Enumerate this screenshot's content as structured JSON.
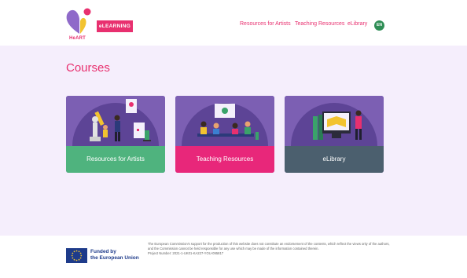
{
  "header": {
    "logo_text": "HeART",
    "badge": "eLEARNING",
    "nav": [
      {
        "label": "Resources for Artists"
      },
      {
        "label": "Teaching Resources"
      },
      {
        "label": "eLibrary"
      }
    ],
    "language": "EN"
  },
  "main": {
    "title": "Courses",
    "cards": [
      {
        "label": "Resources for Artists",
        "color": "#4fb37e"
      },
      {
        "label": "Teaching Resources",
        "color": "#e8277a"
      },
      {
        "label": "eLibrary",
        "color": "#4b5f6e"
      }
    ]
  },
  "footer": {
    "funded_line1": "Funded by",
    "funded_line2": "the European Union",
    "disclaimer": "The European Commission's support for the production of this website does not constitute an endorsement of the contents, which reflect the views only of the authors, and the Commission cannot be held responsible for any use which may be made of the information contained therein.",
    "project_number": "Project Number: 2021-1-UK01-KA227-YOU-095817"
  },
  "colors": {
    "accent": "#e8306f",
    "lang_badge": "#2f8e56",
    "main_bg": "#f5eefc",
    "card_art_bg": "#7c5fb3"
  },
  "icons": [
    "heart-logo-icon",
    "eu-flag-icon"
  ]
}
